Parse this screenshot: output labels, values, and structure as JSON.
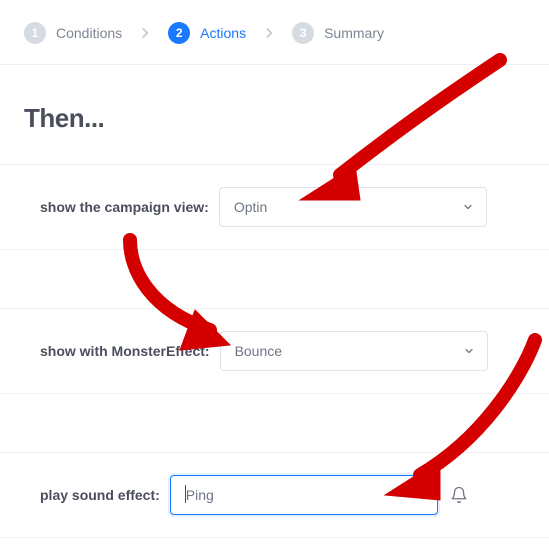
{
  "stepper": {
    "steps": [
      {
        "num": "1",
        "label": "Conditions"
      },
      {
        "num": "2",
        "label": "Actions"
      },
      {
        "num": "3",
        "label": "Summary"
      }
    ],
    "activeIndex": 1
  },
  "heading": "Then...",
  "rows": {
    "campaign": {
      "label": "show the campaign view:",
      "value": "Optin"
    },
    "effect": {
      "label": "show with MonsterEffect:",
      "value": "Bounce"
    },
    "sound": {
      "label": "play sound effect:",
      "value": "Ping"
    }
  },
  "icons": {
    "chevron": "chevron-right",
    "caret": "caret-down",
    "bell": "bell"
  },
  "annotation_color": "#d40000"
}
